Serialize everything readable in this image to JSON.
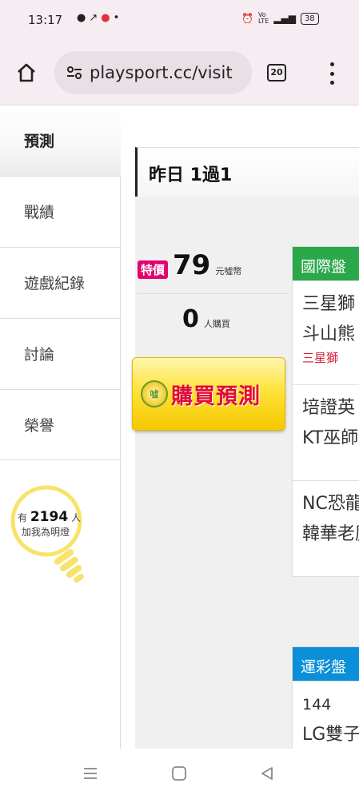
{
  "status_bar": {
    "time": "13:17",
    "left_icons": [
      "chat-icon",
      "missed-call-icon",
      "app-notification-icon",
      "dot-icon"
    ],
    "right_icons": [
      "alarm-icon",
      "volte-icon",
      "signal-4g-icon"
    ],
    "battery": "38"
  },
  "browser": {
    "url": "playsport.cc/visit",
    "tab_count": "20"
  },
  "sidebar": {
    "active_label": "預測",
    "items": [
      {
        "label": "戰績"
      },
      {
        "label": "遊戲紀錄"
      },
      {
        "label": "討論"
      },
      {
        "label": "榮譽"
      }
    ],
    "lamp": {
      "prefix": "有",
      "count": "2194",
      "suffix": "人",
      "line2": "加我為明燈"
    }
  },
  "main": {
    "header": "昨日 1過1",
    "price": {
      "badge": "特價",
      "value": "79",
      "unit": "元噓幣"
    },
    "buyers": {
      "count": "0",
      "label": "人購買"
    },
    "buy_button": {
      "coin": "噓",
      "label": "購買預測"
    },
    "cards": [
      {
        "title": "國際盤",
        "color": "#2aa84a",
        "rows": [
          {
            "line1": "三星獅",
            "line2": "斗山熊",
            "sub": "三星獅"
          },
          {
            "line1": "培證英",
            "line2": "KT巫師"
          },
          {
            "line1": "NC恐龍",
            "line2": "韓華老鷹"
          }
        ]
      },
      {
        "title": "運彩盤",
        "color": "#0b8fd8",
        "rows": [
          {
            "line1": "144",
            "line2": "LG雙子"
          }
        ]
      }
    ]
  },
  "nav_bar": {
    "icons": [
      "recent-apps-icon",
      "home-icon",
      "back-icon"
    ]
  }
}
